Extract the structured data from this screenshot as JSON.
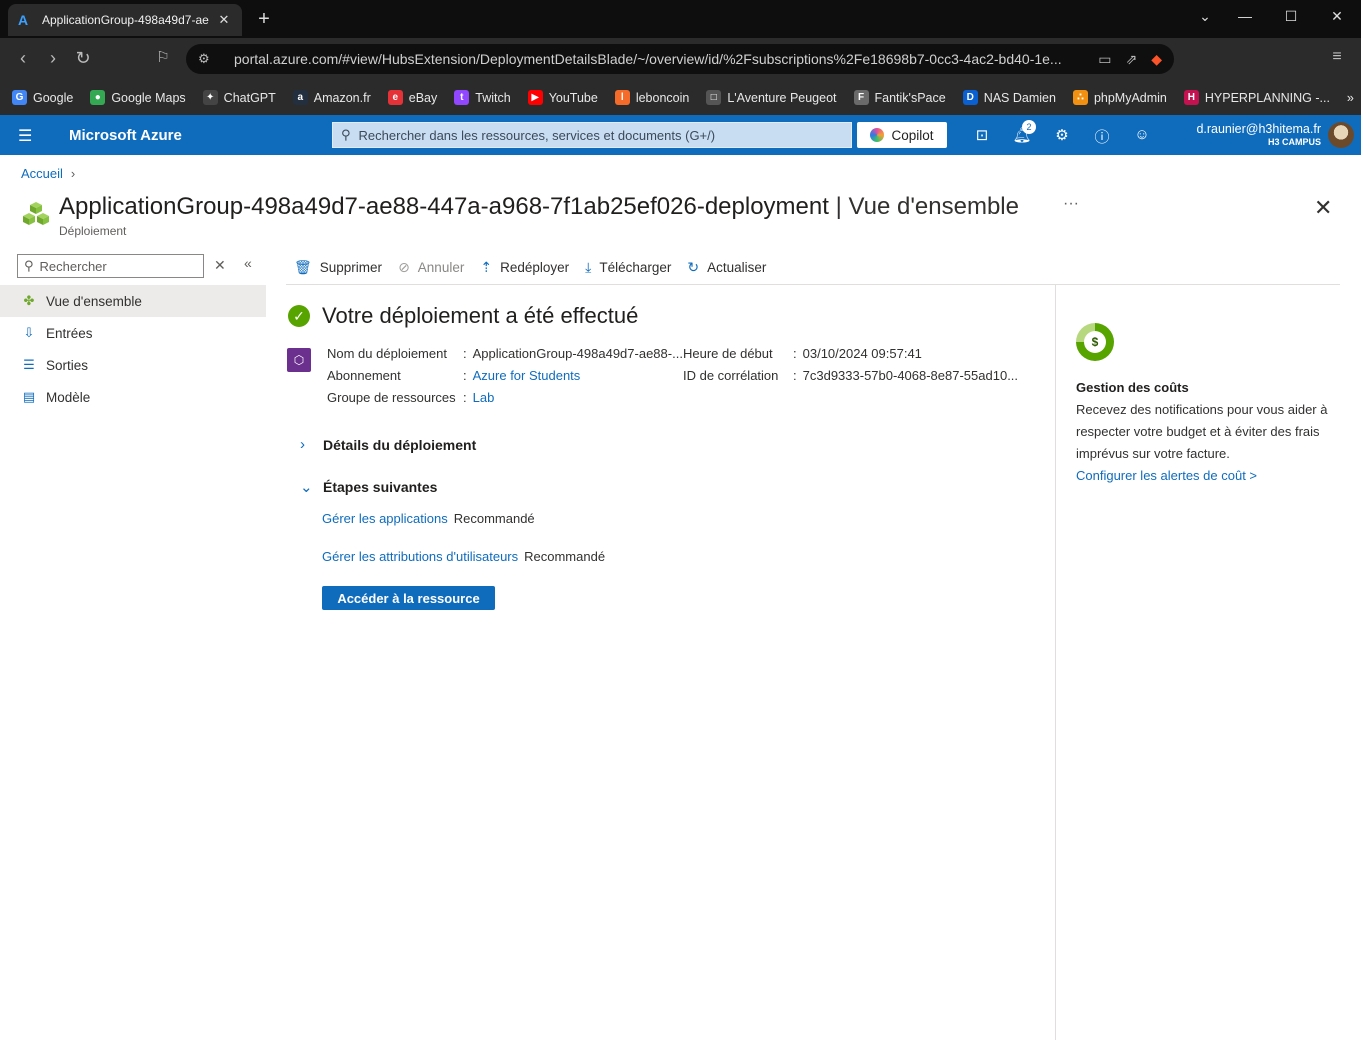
{
  "browser": {
    "tab_title": "ApplicationGroup-498a49d7-ae",
    "url": "portal.azure.com/#view/HubsExtension/DeploymentDetailsBlade/~/overview/id/%2Fsubscriptions%2Fe18698b7-0cc3-4ac2-bd40-1e...",
    "bookmarks": [
      {
        "label": "Google",
        "color": "#4285f4",
        "icon": "G"
      },
      {
        "label": "Google Maps",
        "color": "#34a853",
        "icon": "●"
      },
      {
        "label": "ChatGPT",
        "color": "#444444",
        "icon": "✦"
      },
      {
        "label": "Amazon.fr",
        "color": "#232f3e",
        "icon": "a"
      },
      {
        "label": "eBay",
        "color": "#e53238",
        "icon": "e"
      },
      {
        "label": "Twitch",
        "color": "#9146ff",
        "icon": "t"
      },
      {
        "label": "YouTube",
        "color": "#ff0000",
        "icon": "▶"
      },
      {
        "label": "leboncoin",
        "color": "#f56b2a",
        "icon": "l"
      },
      {
        "label": "L'Aventure Peugeot",
        "color": "#555555",
        "icon": "□"
      },
      {
        "label": "Fantik'sPace",
        "color": "#6a6a6a",
        "icon": "F"
      },
      {
        "label": "NAS Damien",
        "color": "#0a60d0",
        "icon": "D"
      },
      {
        "label": "phpMyAdmin",
        "color": "#f29111",
        "icon": "∴"
      },
      {
        "label": "HYPERPLANNING -...",
        "color": "#c4114f",
        "icon": "H"
      }
    ]
  },
  "azure": {
    "brand": "Microsoft Azure",
    "search_placeholder": "Rechercher dans les ressources, services et documents (G+/)",
    "copilot": "Copilot",
    "notif_count": "2",
    "user_email": "d.raunier@h3hitema.fr",
    "user_org": "H3 CAMPUS"
  },
  "page": {
    "breadcrumb": "Accueil",
    "title": "ApplicationGroup-498a49d7-ae88-447a-a968-7f1ab25ef026-deployment",
    "title_section": "Vue d'ensemble",
    "subtitle": "Déploiement",
    "side_search": "Rechercher",
    "nav": [
      "Vue d'ensemble",
      "Entrées",
      "Sorties",
      "Modèle"
    ],
    "toolbar": {
      "delete": "Supprimer",
      "cancel": "Annuler",
      "redeploy": "Redéployer",
      "download": "Télécharger",
      "refresh": "Actualiser"
    },
    "status": "Votre déploiement a été effectué",
    "props_left": [
      {
        "key": "Nom du déploiement",
        "value": "ApplicationGroup-498a49d7-ae88-..."
      },
      {
        "key": "Abonnement",
        "value": "Azure for Students"
      },
      {
        "key": "Groupe de ressources",
        "value": "Lab"
      }
    ],
    "props_right": [
      {
        "key": "Heure de début",
        "value": "03/10/2024 09:57:41"
      },
      {
        "key": "ID de corrélation",
        "value": "7c3d9333-57b0-4068-8e87-55ad10..."
      }
    ],
    "section_details": "Détails du déploiement",
    "section_next": "Étapes suivantes",
    "steps": [
      {
        "link": "Gérer les applications",
        "tag": "Recommandé"
      },
      {
        "link": "Gérer les attributions d'utilisateurs",
        "tag": "Recommandé"
      }
    ],
    "go_button": "Accéder à la ressource",
    "cost": {
      "title": "Gestion des coûts",
      "body": "Recevez des notifications pour vous aider à respecter votre budget et à éviter des frais imprévus sur votre facture.",
      "link": "Configurer les alertes de coût >"
    }
  }
}
